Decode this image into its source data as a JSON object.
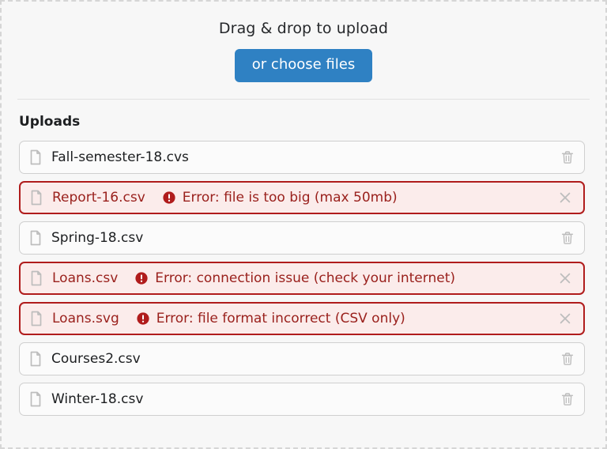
{
  "dropzone": {
    "title": "Drag & drop to upload",
    "choose_button": "or choose files",
    "accent_color": "#2f81c3",
    "error_color": "#b01c1c",
    "error_text_color": "#9a211d",
    "error_bg_color": "#fbeceb",
    "background_color": "#f7f7f7"
  },
  "uploads": {
    "heading": "Uploads",
    "items": [
      {
        "filename": "Fall-semester-18.cvs",
        "state": "ok",
        "error": "",
        "file_icon": "file-icon",
        "action_icon": "trash-icon"
      },
      {
        "filename": "Report-16.csv",
        "state": "error",
        "error": "Error: file is too big (max 50mb)",
        "file_icon": "file-icon",
        "action_icon": "close-icon"
      },
      {
        "filename": "Spring-18.csv",
        "state": "ok",
        "error": "",
        "file_icon": "file-icon",
        "action_icon": "trash-icon"
      },
      {
        "filename": "Loans.csv",
        "state": "error",
        "error": "Error: connection issue (check your internet)",
        "file_icon": "file-icon",
        "action_icon": "close-icon"
      },
      {
        "filename": "Loans.svg",
        "state": "error",
        "error": "Error: file format incorrect (CSV only)",
        "file_icon": "file-icon",
        "action_icon": "close-icon"
      },
      {
        "filename": "Courses2.csv",
        "state": "ok",
        "error": "",
        "file_icon": "file-icon",
        "action_icon": "trash-icon"
      },
      {
        "filename": "Winter-18.csv",
        "state": "ok",
        "error": "",
        "file_icon": "file-icon",
        "action_icon": "trash-icon"
      }
    ]
  }
}
